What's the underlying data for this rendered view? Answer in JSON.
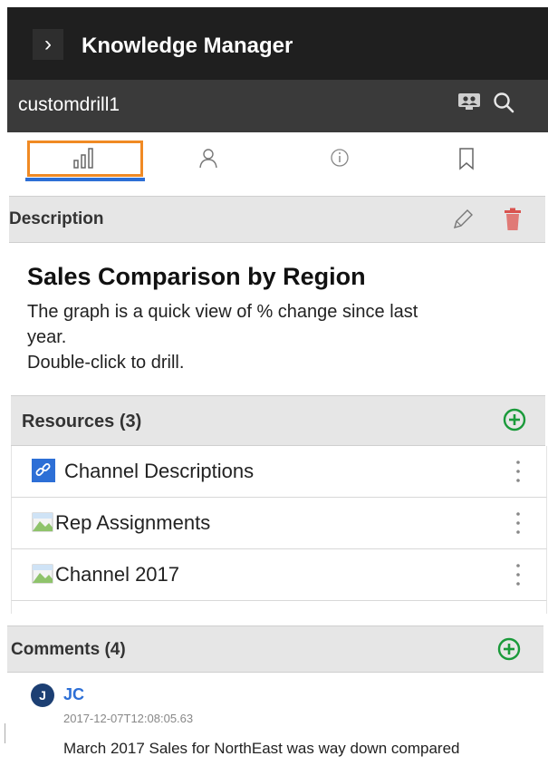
{
  "header": {
    "title": "Knowledge Manager",
    "expand_icon": "chevron-right-icon"
  },
  "subheader": {
    "title": "customdrill1",
    "icons": [
      "presenter-icon",
      "search-icon"
    ]
  },
  "tabs": [
    {
      "icon": "chart-icon",
      "selected": true
    },
    {
      "icon": "user-icon",
      "selected": false
    },
    {
      "icon": "info-icon",
      "selected": false
    },
    {
      "icon": "bookmark-icon",
      "selected": false
    }
  ],
  "description": {
    "label": "Description",
    "title": "Sales Comparison by Region",
    "lines": [
      "The graph is a quick view of % change since last",
      "year.",
      "Double-click to drill."
    ]
  },
  "resources": {
    "label": "Resources (3)",
    "items": [
      {
        "name": "Channel Descriptions",
        "icon": "link-icon"
      },
      {
        "name": "Rep Assignments",
        "icon": "broken-image-icon"
      },
      {
        "name": "Channel 2017",
        "icon": "broken-image-icon"
      }
    ]
  },
  "comments": {
    "label": "Comments (4)",
    "items": [
      {
        "avatar": "J",
        "author": "JC",
        "timestamp": "2017-12-07T12:08:05.63",
        "text": "March 2017 Sales for NorthEast was way down compared"
      }
    ]
  },
  "colors": {
    "accent_orange": "#f08a24",
    "accent_blue": "#2d6fd6",
    "add_green": "#1a9a3a",
    "delete_red": "#d9534f"
  }
}
